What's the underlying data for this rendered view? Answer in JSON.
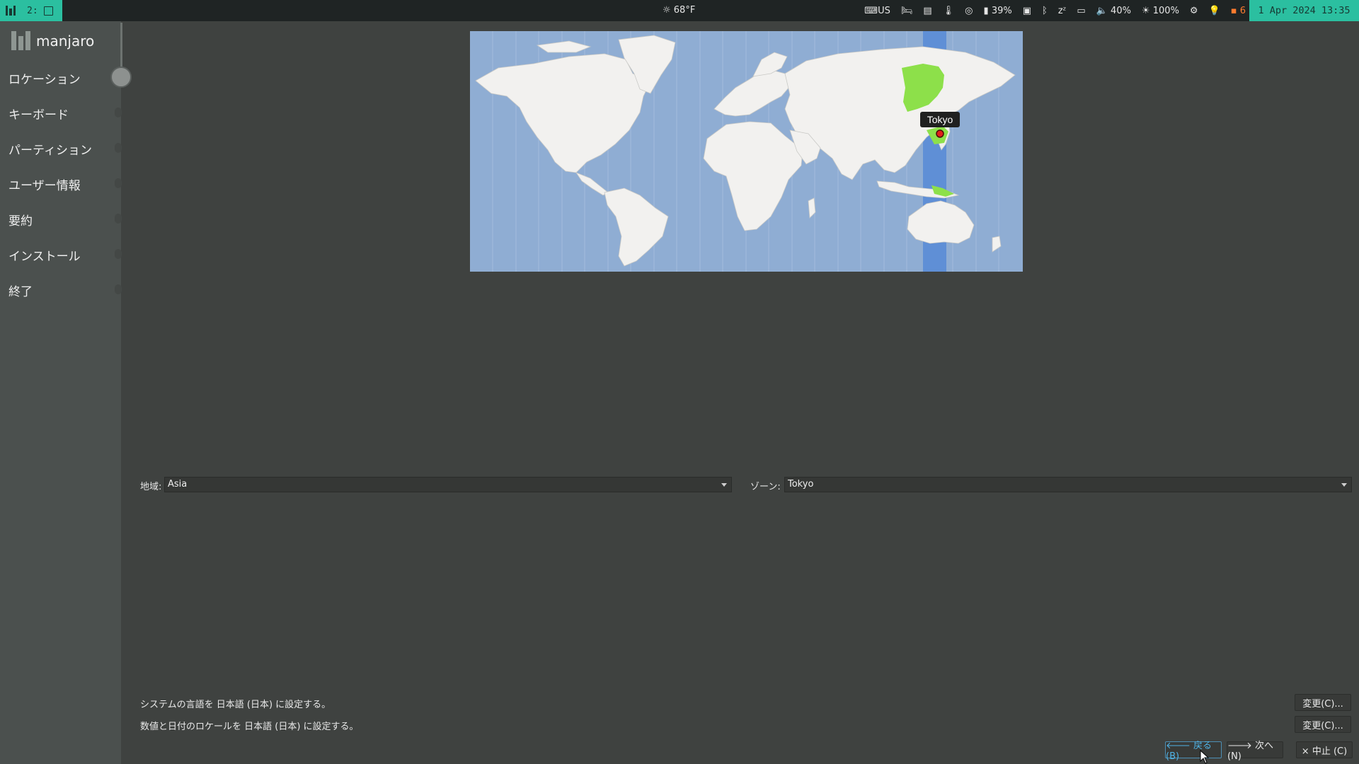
{
  "topbar": {
    "workspace": "2:",
    "weather": "☼ 68°F",
    "tray": {
      "keyboard": "US",
      "battery": "39%",
      "volume": "40%",
      "brightness": "100%",
      "updates": "6"
    },
    "clock": "1 Apr 2024 13:35"
  },
  "sidebar": {
    "brand": "manjaro",
    "steps": [
      "ロケーション",
      "キーボード",
      "パーティション",
      "ユーザー情報",
      "要約",
      "インストール",
      "終了"
    ]
  },
  "map": {
    "selected_city": "Tokyo",
    "colors": {
      "ocean": "#8fadd3",
      "land": "#f2f1ef",
      "zone_band": "#5f8fd6",
      "zone_land": "#8de04a",
      "marker": "#e0201a"
    }
  },
  "region": {
    "label": "地域:",
    "value": "Asia"
  },
  "zone": {
    "label": "ゾーン:",
    "value": "Tokyo"
  },
  "info": {
    "language": "システムの言語を 日本語 (日本) に設定する。",
    "locale": "数値と日付のロケールを 日本語 (日本) に設定する。",
    "change_label": "変更(C)..."
  },
  "buttons": {
    "back": "🡐 戻る (B)",
    "next": "🡒 次へ (N)",
    "cancel": "× 中止 (C)"
  }
}
